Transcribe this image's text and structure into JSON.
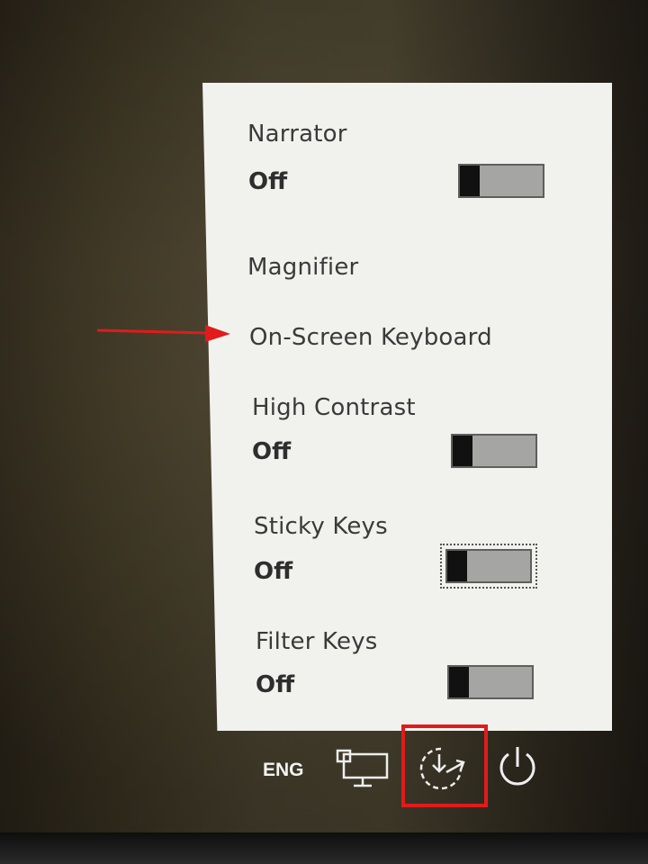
{
  "settings": {
    "narrator": {
      "title": "Narrator",
      "state": "Off"
    },
    "magnifier": {
      "title": "Magnifier"
    },
    "onscreen_keyboard": {
      "title": "On-Screen Keyboard"
    },
    "high_contrast": {
      "title": "High Contrast",
      "state": "Off"
    },
    "sticky_keys": {
      "title": "Sticky Keys",
      "state": "Off"
    },
    "filter_keys": {
      "title": "Filter Keys",
      "state": "Off"
    }
  },
  "taskbar": {
    "language": "ENG",
    "icons": [
      "network-icon",
      "ease-of-access-icon",
      "power-icon"
    ]
  },
  "annotations": {
    "arrow_color": "#e11b1b",
    "highlight_color": "#e11b1b"
  },
  "colors": {
    "panel_bg": "#f1f2ee",
    "toggle_track": "#a5a5a3",
    "toggle_knob": "#111111"
  }
}
